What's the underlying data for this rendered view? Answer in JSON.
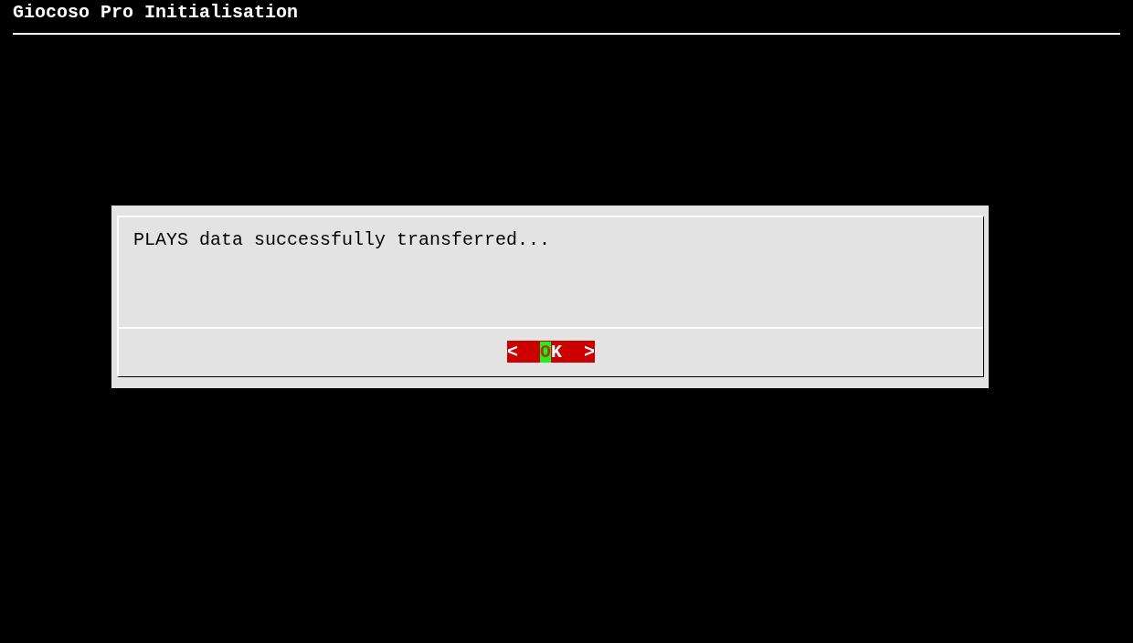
{
  "window": {
    "title": "Giocoso Pro Initialisation"
  },
  "dialog": {
    "message": "PLAYS data successfully transferred...",
    "buttons": [
      {
        "open": "<",
        "label": "OK",
        "close": ">",
        "selected": true
      }
    ]
  }
}
